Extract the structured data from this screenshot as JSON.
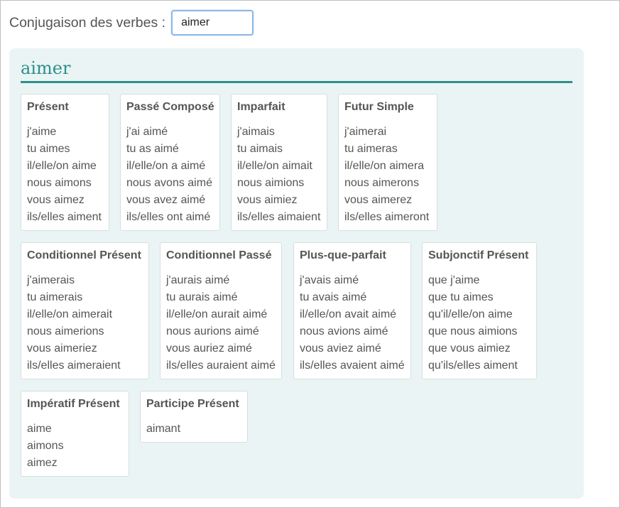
{
  "search": {
    "label": "Conjugaison des verbes :",
    "value": "aimer"
  },
  "verb": "aimer",
  "tenses": [
    {
      "name": "Présent",
      "forms": [
        "j'aime",
        "tu aimes",
        "il/elle/on aime",
        "nous aimons",
        "vous aimez",
        "ils/elles aiment"
      ]
    },
    {
      "name": "Passé Composé",
      "forms": [
        "j'ai aimé",
        "tu as aimé",
        "il/elle/on a aimé",
        "nous avons aimé",
        "vous avez aimé",
        "ils/elles ont aimé"
      ]
    },
    {
      "name": "Imparfait",
      "forms": [
        "j'aimais",
        "tu aimais",
        "il/elle/on aimait",
        "nous aimions",
        "vous aimiez",
        "ils/elles aimaient"
      ]
    },
    {
      "name": "Futur Simple",
      "forms": [
        "j'aimerai",
        "tu aimeras",
        "il/elle/on aimera",
        "nous aimerons",
        "vous aimerez",
        "ils/elles aimeront"
      ]
    },
    {
      "name": "Conditionnel Présent",
      "forms": [
        "j'aimerais",
        "tu aimerais",
        "il/elle/on aimerait",
        "nous aimerions",
        "vous aimeriez",
        "ils/elles aimeraient"
      ]
    },
    {
      "name": "Conditionnel Passé",
      "forms": [
        "j'aurais aimé",
        "tu aurais aimé",
        "il/elle/on aurait aimé",
        "nous aurions aimé",
        "vous auriez aimé",
        "ils/elles auraient aimé"
      ]
    },
    {
      "name": "Plus-que-parfait",
      "forms": [
        "j'avais aimé",
        "tu avais aimé",
        "il/elle/on avait aimé",
        "nous avions aimé",
        "vous aviez aimé",
        "ils/elles avaient aimé"
      ]
    },
    {
      "name": "Subjonctif Présent",
      "forms": [
        "que j'aime",
        "que tu aimes",
        "qu'il/elle/on aime",
        "que nous aimions",
        "que vous aimiez",
        "qu'ils/elles aiment"
      ]
    },
    {
      "name": "Impératif Présent",
      "forms": [
        "aime",
        "aimons",
        "aimez"
      ]
    },
    {
      "name": "Participe Présent",
      "forms": [
        "aimant"
      ]
    }
  ]
}
